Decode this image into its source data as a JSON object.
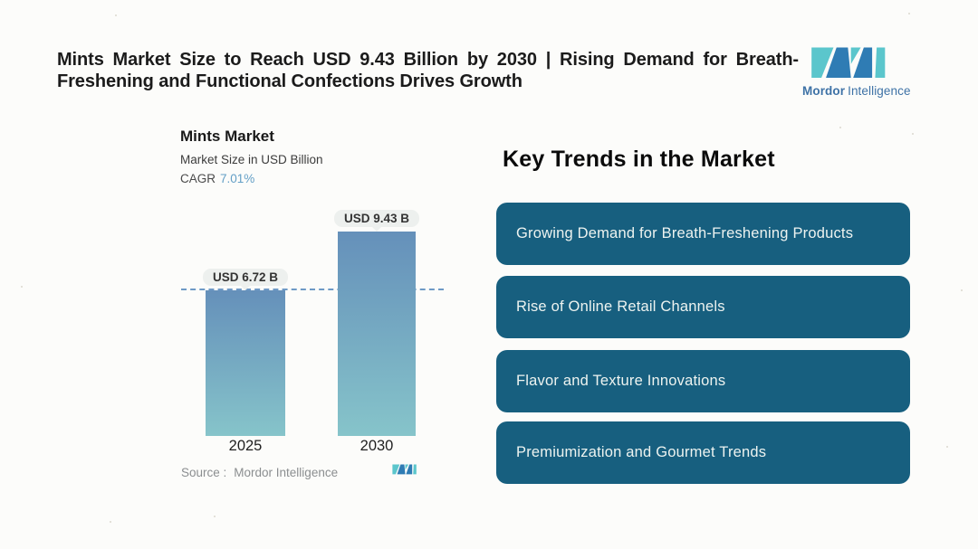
{
  "header": {
    "title_line1": "Mints Market Size to Reach USD 9.43 Billion by 2030 | Rising Demand for Breath-",
    "title_line2": "Freshening and Functional Confections Drives Growth"
  },
  "brand": {
    "name_bold": "Mordor",
    "name_regular": "Intelligence",
    "colors": {
      "teal": "#5bc6cc",
      "blue": "#2f7cb4",
      "text": "#3e72a6"
    }
  },
  "chart": {
    "title": "Mints Market",
    "subtitle": "Market Size in USD Billion",
    "cagr_label": "CAGR",
    "cagr_value": "7.01%",
    "bars": [
      {
        "year": "2025",
        "label": "USD 6.72 B",
        "value": 6.72
      },
      {
        "year": "2030",
        "label": "USD 9.43 B",
        "value": 9.43
      }
    ],
    "source_label": "Source :",
    "source_value": "Mordor Intelligence",
    "bar_gradient_top": "#6590ba",
    "bar_gradient_bottom": "#86c4ca",
    "dashed_line_color": "#6e9ac6"
  },
  "chart_data": {
    "type": "bar",
    "title": "Mints Market",
    "subtitle": "Market Size in USD Billion",
    "categories": [
      "2025",
      "2030"
    ],
    "values": [
      6.72,
      9.43
    ],
    "data_labels": [
      "USD 6.72 B",
      "USD 9.43 B"
    ],
    "cagr": "7.01%",
    "xlabel": "",
    "ylabel": "Market Size in USD Billion",
    "ylim": [
      0,
      9.43
    ],
    "grid": false,
    "legend": false,
    "annotations": [
      "horizontal dashed reference line at 2025 value (6.72)"
    ]
  },
  "trends": {
    "heading": "Key Trends in the Market",
    "card_color": "#175f7f",
    "items": [
      {
        "label": "Growing Demand for Breath-Freshening Products"
      },
      {
        "label": "Rise of Online Retail Channels"
      },
      {
        "label": "Flavor and Texture Innovations"
      },
      {
        "label": "Premiumization and Gourmet Trends"
      }
    ]
  }
}
